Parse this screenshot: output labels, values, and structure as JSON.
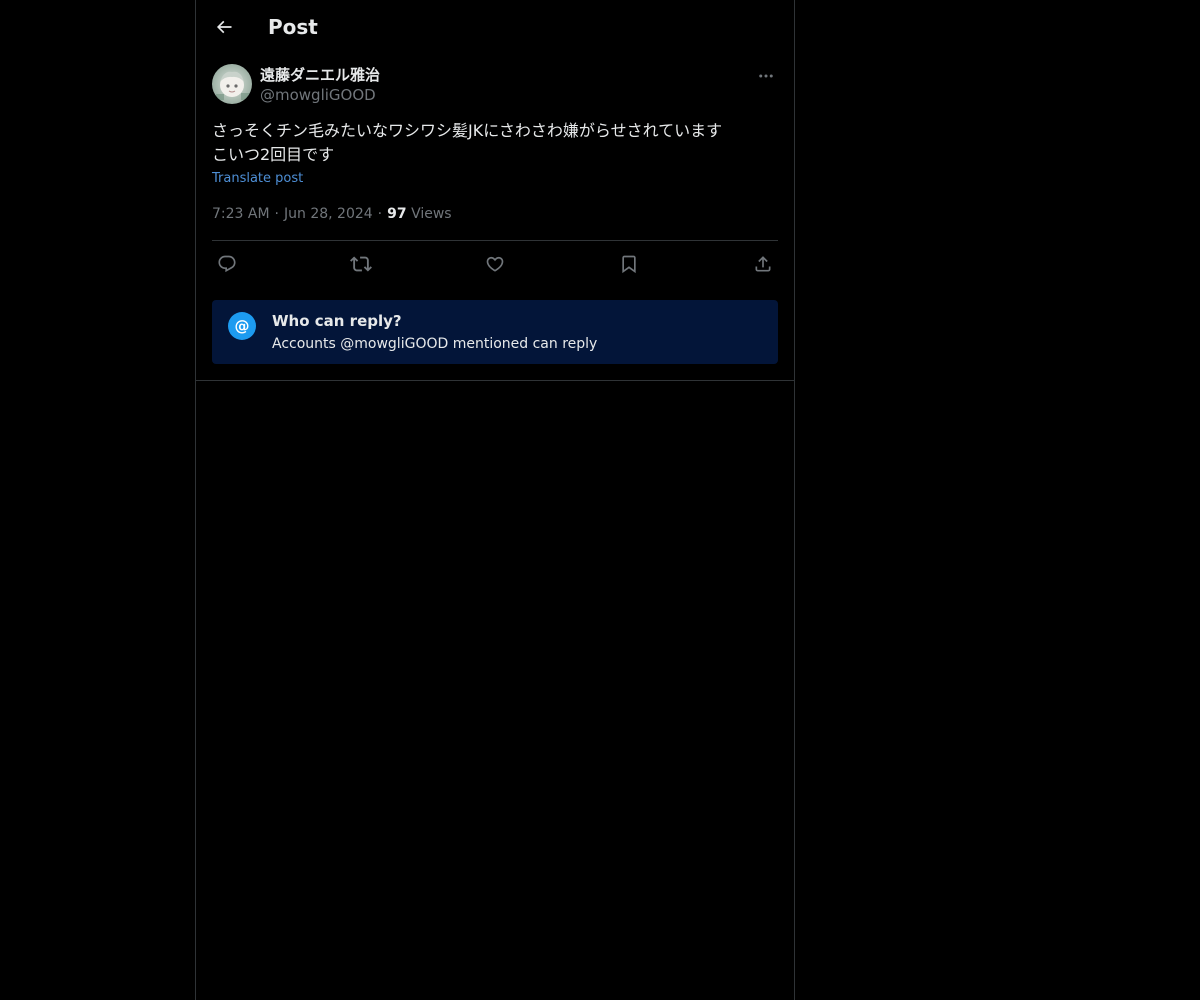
{
  "header": {
    "title": "Post",
    "back_icon": "arrow-left-icon"
  },
  "post": {
    "author": {
      "display_name": "遠藤ダニエル雅治",
      "handle": "@mowgliGOOD"
    },
    "text": "さっそくチン毛みたいなワシワシ髪JKにさわさわ嫌がらせされています\nこいつ2回目です",
    "translate_label": "Translate post",
    "time": "7:23 AM",
    "separator": "·",
    "date": "Jun 28, 2024",
    "views_count": "97",
    "views_label": "Views",
    "actions": [
      {
        "name": "reply",
        "icon": "reply-icon"
      },
      {
        "name": "repost",
        "icon": "repost-icon"
      },
      {
        "name": "like",
        "icon": "heart-icon"
      },
      {
        "name": "bookmark",
        "icon": "bookmark-icon"
      },
      {
        "name": "share",
        "icon": "share-icon"
      }
    ]
  },
  "reply_restriction": {
    "icon_glyph": "@",
    "title": "Who can reply?",
    "description": "Accounts @mowgliGOOD mentioned can reply"
  },
  "colors": {
    "background": "#000000",
    "text_primary": "#e7e9ea",
    "text_secondary": "#71767b",
    "link": "#4e8fd6",
    "accent": "#1d9bf0",
    "reply_card_bg": "#031539",
    "border": "#2f3336"
  }
}
